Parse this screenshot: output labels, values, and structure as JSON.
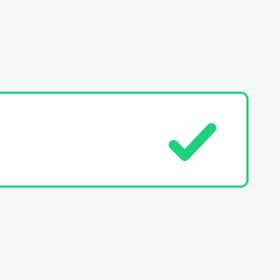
{
  "colors": {
    "background": "#f7f8fa",
    "field_background": "#ffffff",
    "success": "#1bd17a"
  },
  "field": {
    "value": "",
    "state": "valid"
  },
  "icons": {
    "status": "checkmark-icon"
  }
}
